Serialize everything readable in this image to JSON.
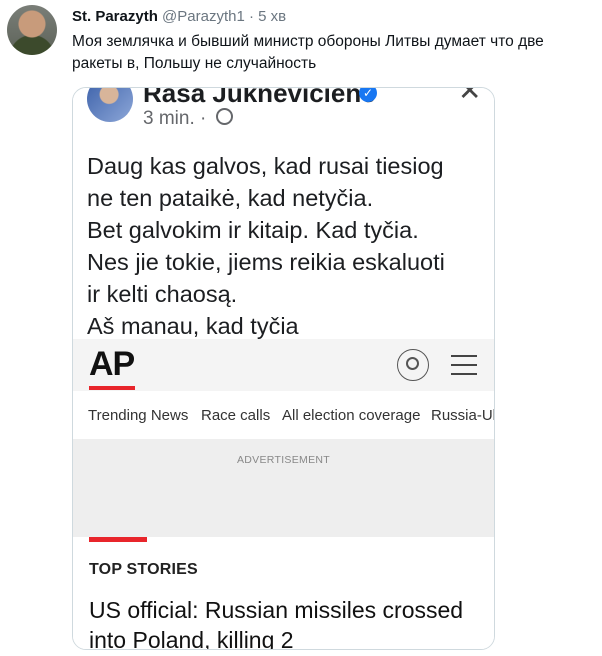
{
  "tweet": {
    "name": "St. Parazyth",
    "handle": "@Parazyth1",
    "separator": "·",
    "time": "5 хв",
    "text": "Моя землячка и бывший министр обороны Литвы думает что две ракеты в, Польшу не случайность"
  },
  "fb_post": {
    "author": "Rasa Juknevičienė",
    "time": "3 min.",
    "dot": "·",
    "lines": [
      "Daug kas galvos, kad rusai tiesiog",
      "ne ten pataikė, kad netyčia.",
      "Bet galvokim ir kitaip. Kad tyčia.",
      "Nes jie tokie, jiems reikia eskaluoti",
      "ir kelti chaosą.",
      "Aš manau, kad tyčia"
    ]
  },
  "ap": {
    "logo": "AP",
    "nav": [
      "Trending News",
      "Race calls",
      "All election coverage",
      "Russia-Uk"
    ],
    "ad_label": "ADVERTISEMENT",
    "section_title": "TOP STORIES",
    "headline": "US official: Russian missiles crossed into Poland, killing 2"
  },
  "colors": {
    "ap_red": "#e8252b",
    "fb_blue": "#1877f2"
  }
}
